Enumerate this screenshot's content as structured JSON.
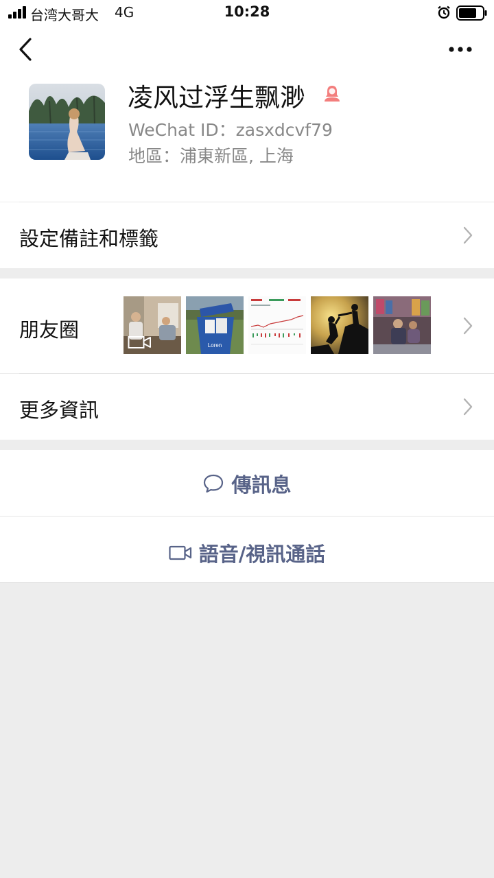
{
  "status": {
    "carrier": "台湾大哥大",
    "network": "4G",
    "time": "10:28"
  },
  "profile": {
    "nickname": "凌风过浮生飘渺",
    "wechat_id": "WeChat ID：zasxdcvf79",
    "region": "地區：浦東新區, 上海",
    "gender_icon": "female-icon",
    "gender_color": "#f37e7d"
  },
  "rows": {
    "remark_label": "設定備註和標籤",
    "moments_label": "朋友圈",
    "more_info_label": "更多資訊"
  },
  "moments": [
    {
      "name": "moment-video-thumb",
      "is_video": true
    },
    {
      "name": "moment-recycling-bin-thumb"
    },
    {
      "name": "moment-stock-chart-thumb"
    },
    {
      "name": "moment-climbers-silhouette-thumb"
    },
    {
      "name": "moment-shop-thumb"
    }
  ],
  "actions": {
    "message_label": "傳訊息",
    "call_label": "語音/視訊通話"
  },
  "colors": {
    "accent": "#586388",
    "background": "#ededed",
    "secondary_text": "#888888"
  }
}
